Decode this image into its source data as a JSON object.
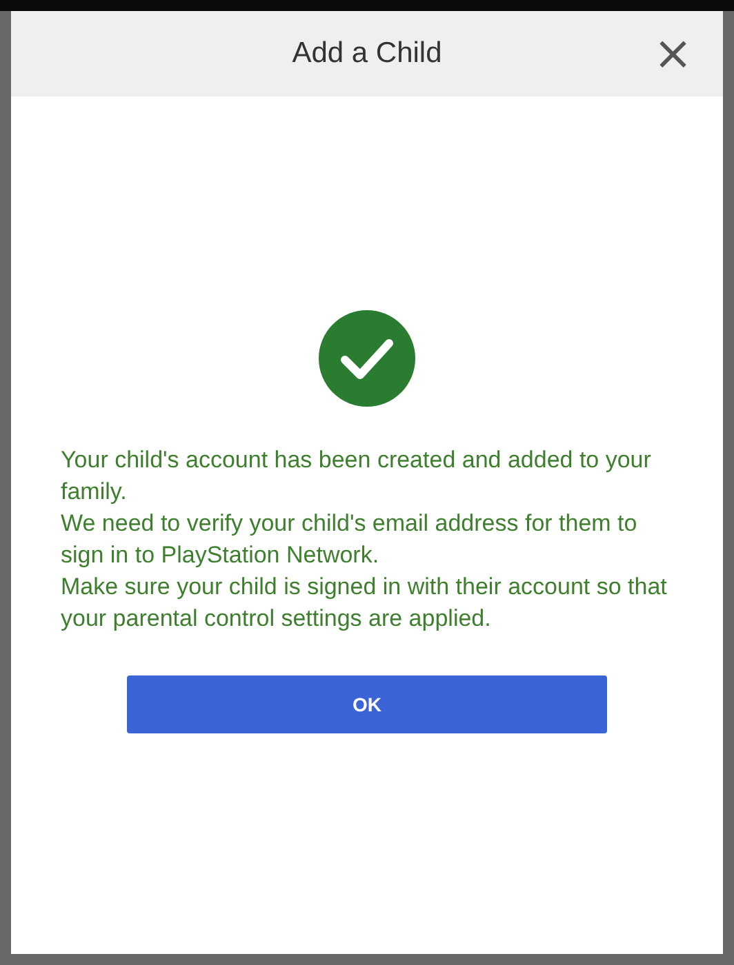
{
  "dialog": {
    "title": "Add a Child",
    "close": "×",
    "message_lines": [
      "Your child's account has been created and added to your family.",
      "We need to verify your child's email address for them to sign in to PlayStation Network.",
      "Make sure your child is signed in with their account so that your parental control settings are applied."
    ],
    "button": "OK"
  }
}
